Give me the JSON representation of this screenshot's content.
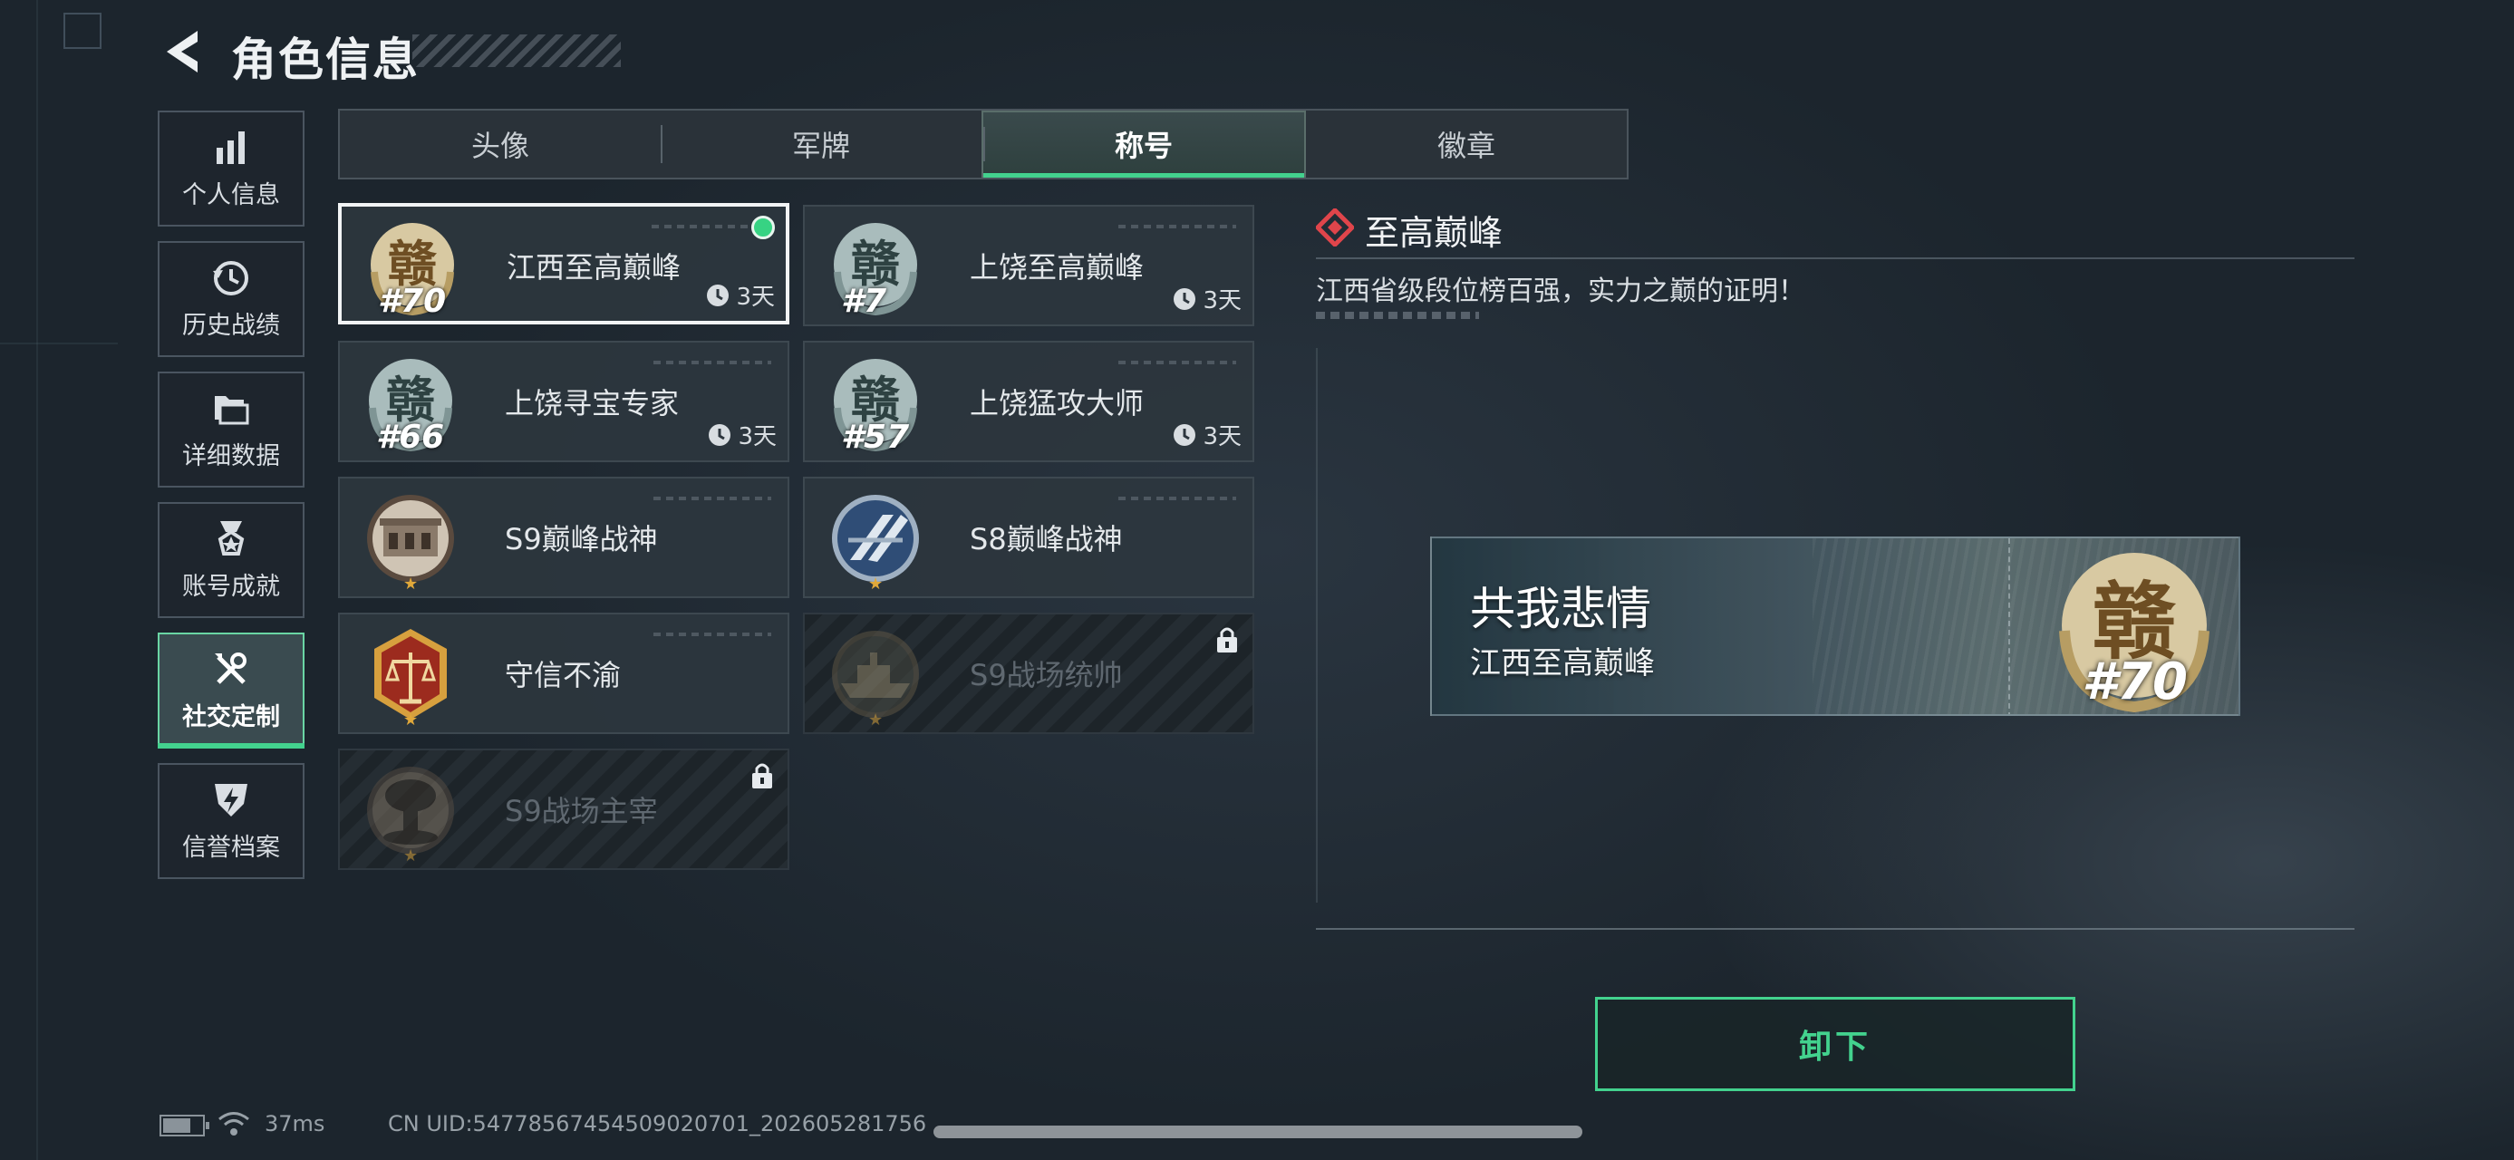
{
  "header": {
    "title": "角色信息"
  },
  "nav": [
    {
      "label": "个人信息",
      "icon": "bar-chart-icon",
      "active": false
    },
    {
      "label": "历史战绩",
      "icon": "history-icon",
      "active": false
    },
    {
      "label": "详细数据",
      "icon": "folder-icon",
      "active": false
    },
    {
      "label": "账号成就",
      "icon": "medal-icon",
      "active": false
    },
    {
      "label": "社交定制",
      "icon": "tools-icon",
      "active": true
    },
    {
      "label": "信誉档案",
      "icon": "shield-bolt-icon",
      "active": false
    }
  ],
  "tabs": [
    {
      "label": "头像",
      "active": false
    },
    {
      "label": "军牌",
      "active": false
    },
    {
      "label": "称号",
      "active": true
    },
    {
      "label": "徽章",
      "active": false
    }
  ],
  "titles": [
    {
      "name": "江西至高巅峰",
      "rank": "#70",
      "timer": "3天",
      "emblem": "gan-emblem-icon",
      "selected": true,
      "equipped": true,
      "locked": false
    },
    {
      "name": "上饶至高巅峰",
      "rank": "#7",
      "timer": "3天",
      "emblem": "gan-emblem-icon",
      "selected": false,
      "equipped": false,
      "locked": false
    },
    {
      "name": "上饶寻宝专家",
      "rank": "#66",
      "timer": "3天",
      "emblem": "gan-emblem-icon",
      "selected": false,
      "equipped": false,
      "locked": false
    },
    {
      "name": "上饶猛攻大师",
      "rank": "#57",
      "timer": "3天",
      "emblem": "gan-emblem-icon",
      "selected": false,
      "equipped": false,
      "locked": false
    },
    {
      "name": "S9巅峰战神",
      "emblem": "fortress-emblem-icon",
      "selected": false,
      "equipped": false,
      "locked": false
    },
    {
      "name": "S8巅峰战神",
      "emblem": "striped-emblem-icon",
      "selected": false,
      "equipped": false,
      "locked": false
    },
    {
      "name": "守信不渝",
      "emblem": "scales-emblem-icon",
      "selected": false,
      "equipped": false,
      "locked": false
    },
    {
      "name": "S9战场统帅",
      "emblem": "ship-emblem-icon",
      "selected": false,
      "equipped": false,
      "locked": true
    },
    {
      "name": "S9战场主宰",
      "emblem": "mushroom-cloud-emblem-icon",
      "selected": false,
      "equipped": false,
      "locked": true
    }
  ],
  "detail": {
    "title": "至高巅峰",
    "description": "江西省级段位榜百强，实力之巅的证明！",
    "preview_title": "共我悲情",
    "preview_subtitle": "江西至高巅峰",
    "preview_rank": "#70"
  },
  "actions": {
    "unequip_label": "卸下"
  },
  "status": {
    "ping": "37ms",
    "uid": "CN UID:5477856745450902070​1_20260528175‌6"
  },
  "colors": {
    "accent": "#43d28e",
    "panel": "#2d363e",
    "selected_border": "#f2f4f5",
    "diamond": "#e0454b"
  }
}
